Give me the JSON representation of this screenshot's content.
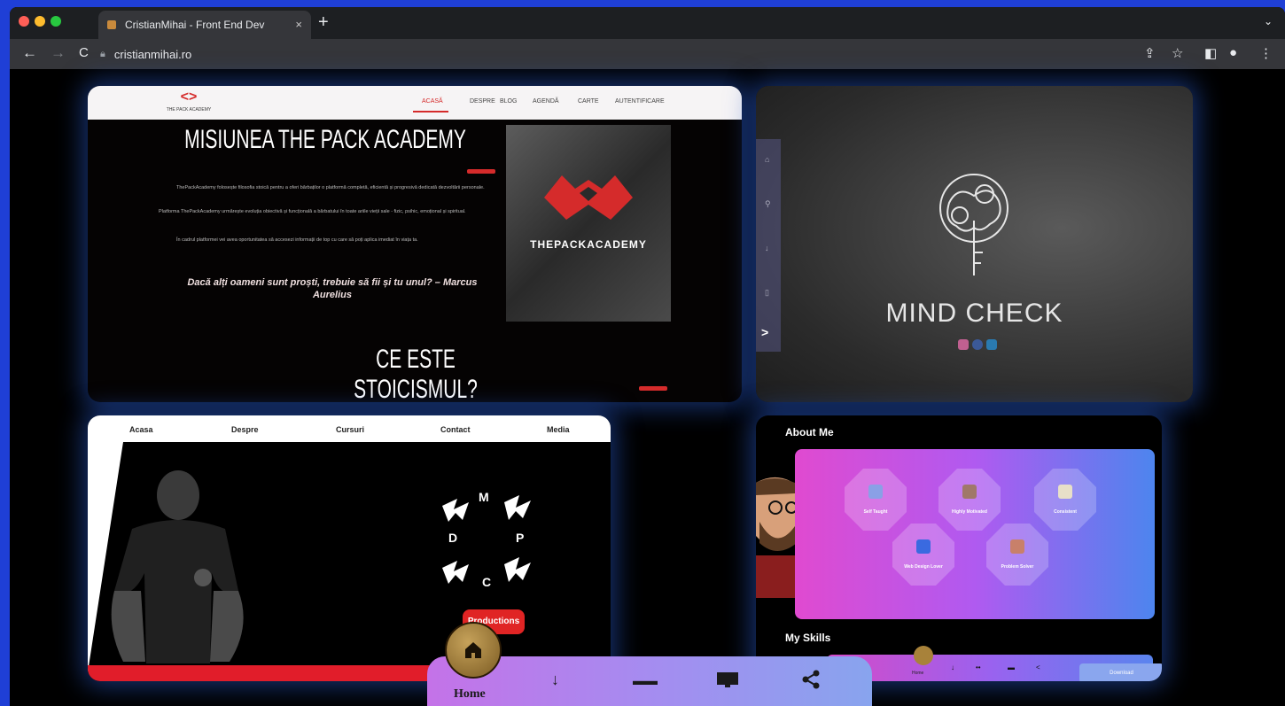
{
  "browser": {
    "tab_title": "CristianMihai - Front End Dev",
    "tab_close": "×",
    "new_tab": "+",
    "url": "cristianmihai.ro"
  },
  "projects": {
    "pack_academy": {
      "logo_text": "THE PACK ACADEMY",
      "nav": [
        "ACASĂ",
        "DESPRE",
        "BLOG",
        "AGENDĂ",
        "CARTE",
        "AUTENTIFICARE"
      ],
      "headline": "MISIUNEA THE PACK ACADEMY",
      "paragraphs": [
        "ThePackAcademy folosește filosofia stoică pentru a oferi bărbaților o platformă completă, eficientă și progresivă dedicată dezvoltării personale.",
        "Platforma ThePackAcademy urmărește evoluția obiectivă și funcțională a bărbatului în toate ariile vieții sale - fizic, psihic, emoțional și spiritual.",
        "În cadrul platformei vei avea oportunitatea să accesezi informații de top cu care să poți aplica imediat în viața ta."
      ],
      "quote": "Dacă alți oameni sunt proști, trebuie să fii și tu unul? – Marcus Aurelius",
      "image_text": "THEPACKACADEMY",
      "headline2": "CE ESTE STOICISMUL?"
    },
    "mind_check": {
      "title": "MIND CHECK",
      "nav_arrow": ">"
    },
    "dmpc": {
      "nav": [
        "Acasa",
        "Despre",
        "Cursuri",
        "Contact",
        "Media"
      ],
      "letters": [
        "M",
        "D",
        "P",
        "C"
      ],
      "productions": "Productions"
    },
    "portfolio": {
      "about_title": "About Me",
      "skills_title": "My Skills",
      "traits": [
        "Self Taught",
        "Highly Motivated",
        "Consistent",
        "Web Design Lover",
        "Problem Solver"
      ],
      "home_mini": "Home",
      "download_btn": "Download"
    }
  },
  "bottom_nav": {
    "home_label": "Home",
    "icons": [
      "home-icon",
      "arrow-down-icon",
      "glasses-icon",
      "monitor-icon",
      "share-icon"
    ]
  },
  "colors": {
    "accent_red": "#d52b2b",
    "nav_gradient_start": "#c472e8",
    "nav_gradient_end": "#88a4ee",
    "page_bg": "#1f3fd6"
  }
}
